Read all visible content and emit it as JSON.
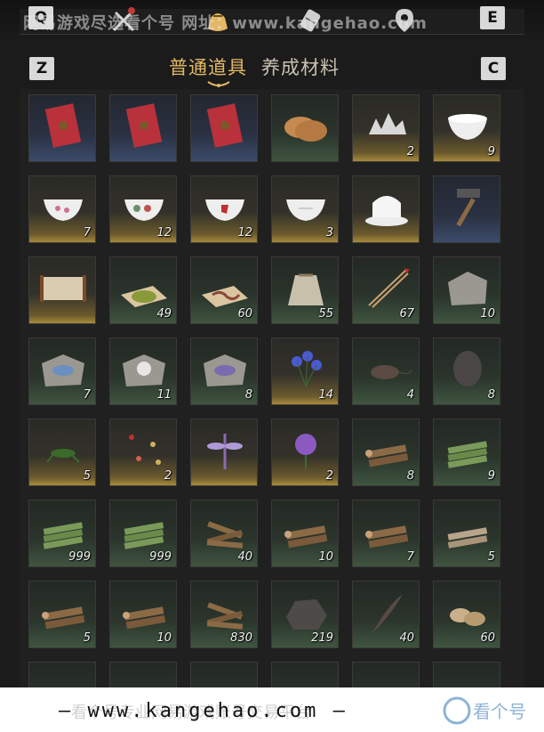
{
  "hotkeys": {
    "prev_category": "Q",
    "next_category": "E",
    "prev_tab": "Z",
    "next_tab": "C"
  },
  "tabs": [
    {
      "label": "普通道具",
      "active": true
    },
    {
      "label": "养成材料",
      "active": false
    }
  ],
  "top_icons": [
    "weapons-icon",
    "pouch-icon",
    "scroll-icon",
    "map-pin-icon"
  ],
  "watermark": "网易游戏尽选看个号 网址：www.kangehao.com",
  "footer": {
    "url": "— www.kangehao.com —",
    "ghost": "看个号专业网易游戏账号交易平台",
    "logo": "看个号"
  },
  "colors": {
    "active_tab": "#e3b765",
    "rarity_gold": "#a88a3c",
    "rarity_green": "#3f5540",
    "rarity_blue": "#3b4c6a"
  },
  "inventory": [
    {
      "name": "red-envelope",
      "qty": "",
      "rarity": "blue"
    },
    {
      "name": "red-envelope",
      "qty": "",
      "rarity": "blue"
    },
    {
      "name": "red-envelope",
      "qty": "",
      "rarity": "blue"
    },
    {
      "name": "flatbread",
      "qty": "",
      "rarity": "green"
    },
    {
      "name": "stone-landscape",
      "qty": "2",
      "rarity": "gold"
    },
    {
      "name": "porcelain-bowl",
      "qty": "9",
      "rarity": "gold"
    },
    {
      "name": "porcelain-bowl-floral",
      "qty": "7",
      "rarity": "gold"
    },
    {
      "name": "porcelain-bowl-painted",
      "qty": "12",
      "rarity": "gold"
    },
    {
      "name": "porcelain-bowl-rooster",
      "qty": "12",
      "rarity": "gold"
    },
    {
      "name": "porcelain-bowl-plain",
      "qty": "3",
      "rarity": "gold"
    },
    {
      "name": "covered-tea-bowl",
      "qty": "",
      "rarity": "gold"
    },
    {
      "name": "hammer",
      "qty": "",
      "rarity": "blue"
    },
    {
      "name": "painting-scroll",
      "qty": "",
      "rarity": "gold"
    },
    {
      "name": "herb-powder",
      "qty": "49",
      "rarity": "green"
    },
    {
      "name": "worm-on-paper",
      "qty": "60",
      "rarity": "green"
    },
    {
      "name": "cloth-sack",
      "qty": "55",
      "rarity": "green"
    },
    {
      "name": "arrows",
      "qty": "67",
      "rarity": "green"
    },
    {
      "name": "carved-stone",
      "qty": "10",
      "rarity": "green"
    },
    {
      "name": "mural-stone-blue",
      "qty": "7",
      "rarity": "green"
    },
    {
      "name": "mural-stone-figure",
      "qty": "11",
      "rarity": "green"
    },
    {
      "name": "mural-stone-violet",
      "qty": "8",
      "rarity": "green"
    },
    {
      "name": "blue-flowers",
      "qty": "14",
      "rarity": "gold"
    },
    {
      "name": "rat",
      "qty": "4",
      "rarity": "green"
    },
    {
      "name": "dark-egg",
      "qty": "8",
      "rarity": "green"
    },
    {
      "name": "grasshopper",
      "qty": "5",
      "rarity": "gold"
    },
    {
      "name": "fireflies",
      "qty": "2",
      "rarity": "gold"
    },
    {
      "name": "purple-dragonfly",
      "qty": "",
      "rarity": "gold"
    },
    {
      "name": "purple-flower",
      "qty": "2",
      "rarity": "gold"
    },
    {
      "name": "wood-logs",
      "qty": "8",
      "rarity": "green"
    },
    {
      "name": "bamboo-bundle",
      "qty": "9",
      "rarity": "green"
    },
    {
      "name": "bamboo-bundle",
      "qty": "999",
      "rarity": "green"
    },
    {
      "name": "bamboo-bundle",
      "qty": "999",
      "rarity": "green"
    },
    {
      "name": "firewood",
      "qty": "40",
      "rarity": "green"
    },
    {
      "name": "wood-logs",
      "qty": "10",
      "rarity": "green"
    },
    {
      "name": "wood-logs",
      "qty": "7",
      "rarity": "green"
    },
    {
      "name": "pale-logs",
      "qty": "5",
      "rarity": "green"
    },
    {
      "name": "wood-logs",
      "qty": "5",
      "rarity": "green"
    },
    {
      "name": "wood-logs",
      "qty": "10",
      "rarity": "green"
    },
    {
      "name": "firewood",
      "qty": "830",
      "rarity": "green"
    },
    {
      "name": "iron-ore",
      "qty": "219",
      "rarity": "green"
    },
    {
      "name": "feather",
      "qty": "40",
      "rarity": "green"
    },
    {
      "name": "mushroom-slices",
      "qty": "60",
      "rarity": "green"
    },
    {
      "name": "partial-item",
      "qty": "",
      "rarity": "green"
    },
    {
      "name": "partial-item",
      "qty": "",
      "rarity": "green"
    },
    {
      "name": "partial-item",
      "qty": "",
      "rarity": "green"
    },
    {
      "name": "partial-item",
      "qty": "",
      "rarity": "green"
    },
    {
      "name": "partial-item",
      "qty": "",
      "rarity": "green"
    },
    {
      "name": "partial-item",
      "qty": "",
      "rarity": "green"
    }
  ]
}
